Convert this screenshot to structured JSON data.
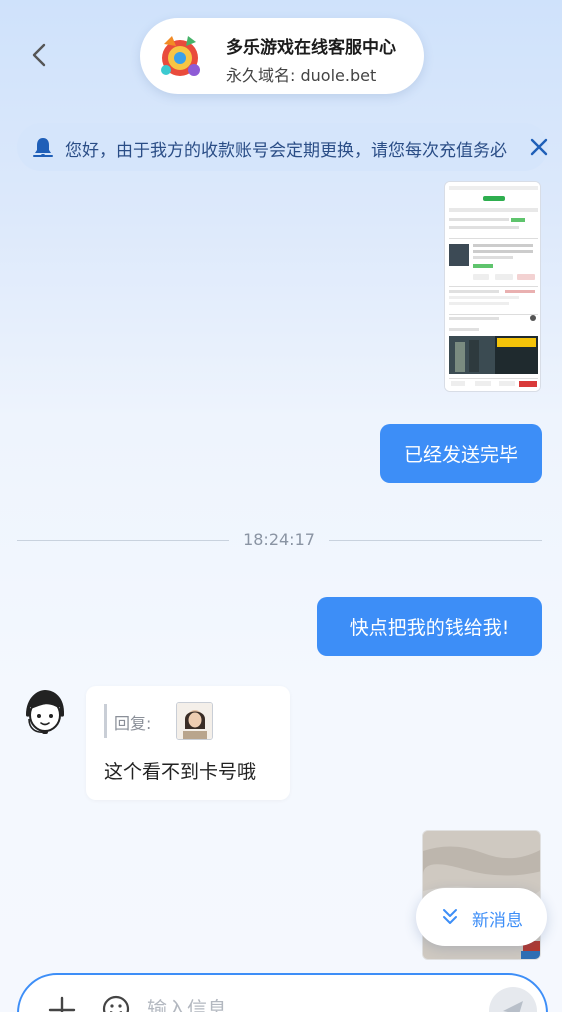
{
  "header": {
    "title": "多乐游戏在线客服中心",
    "subtitle": "永久域名: duole.bet"
  },
  "notice": {
    "text": "您好，由于我方的收款账号会定期更换，请您每次充值务必"
  },
  "messages": {
    "sent_1": "已经发送完毕",
    "timestamp": "18:24:17",
    "sent_2": "快点把我的钱给我!",
    "agent_reply_label": "回复:",
    "agent_text": "这个看不到卡号哦"
  },
  "new_messages_label": "新消息",
  "input": {
    "placeholder": "输入信息"
  },
  "colors": {
    "accent": "#3d8ef7",
    "notice_bg": "#d5e5fb",
    "notice_text": "#2a4d86"
  }
}
